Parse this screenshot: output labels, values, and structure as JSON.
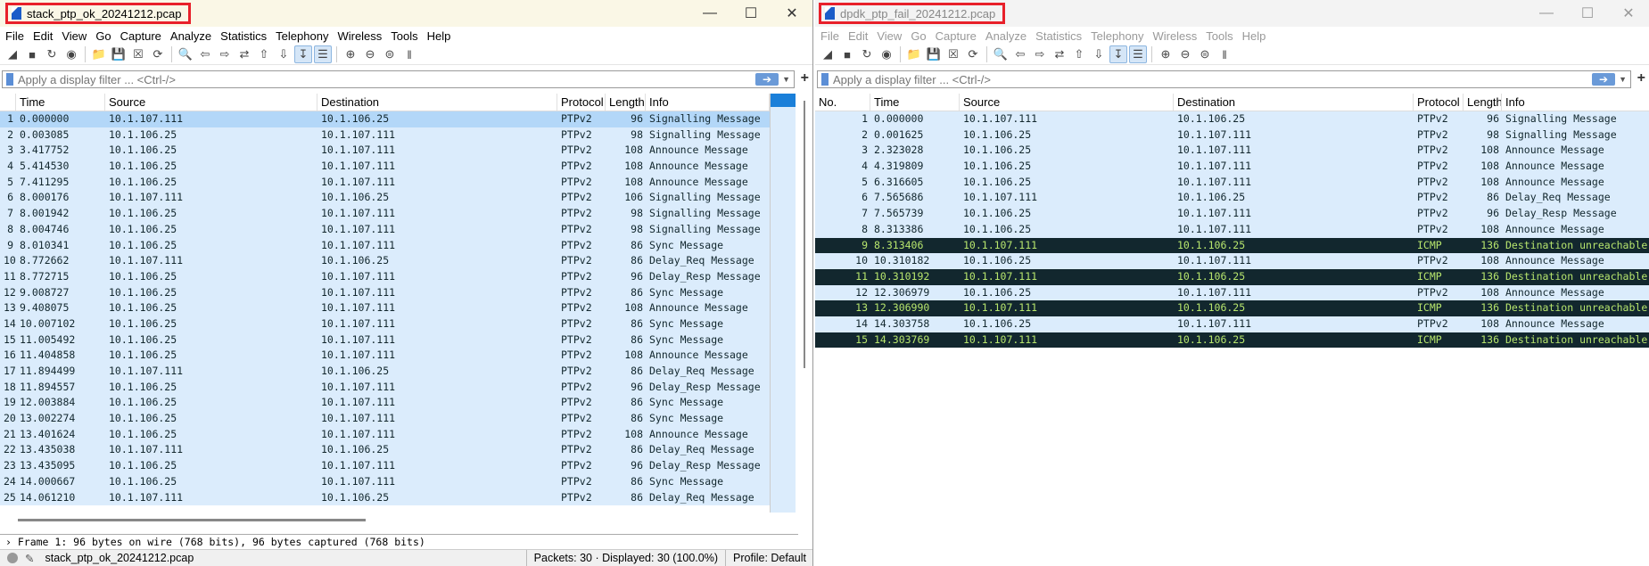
{
  "menu": [
    "File",
    "Edit",
    "View",
    "Go",
    "Capture",
    "Analyze",
    "Statistics",
    "Telephony",
    "Wireless",
    "Tools",
    "Help"
  ],
  "filter_placeholder": "Apply a display filter ... <Ctrl-/>",
  "columns": [
    "No.",
    "Time",
    "Source",
    "Destination",
    "Protocol",
    "Length",
    "Info"
  ],
  "left": {
    "title": "stack_ptp_ok_20241212.pcap",
    "header_no": "",
    "rows": [
      [
        "1",
        "0.000000",
        "10.1.107.111",
        "10.1.106.25",
        "PTPv2",
        "96",
        "Signalling Message"
      ],
      [
        "2",
        "0.003085",
        "10.1.106.25",
        "10.1.107.111",
        "PTPv2",
        "98",
        "Signalling Message"
      ],
      [
        "3",
        "3.417752",
        "10.1.106.25",
        "10.1.107.111",
        "PTPv2",
        "108",
        "Announce Message"
      ],
      [
        "4",
        "5.414530",
        "10.1.106.25",
        "10.1.107.111",
        "PTPv2",
        "108",
        "Announce Message"
      ],
      [
        "5",
        "7.411295",
        "10.1.106.25",
        "10.1.107.111",
        "PTPv2",
        "108",
        "Announce Message"
      ],
      [
        "6",
        "8.000176",
        "10.1.107.111",
        "10.1.106.25",
        "PTPv2",
        "106",
        "Signalling Message"
      ],
      [
        "7",
        "8.001942",
        "10.1.106.25",
        "10.1.107.111",
        "PTPv2",
        "98",
        "Signalling Message"
      ],
      [
        "8",
        "8.004746",
        "10.1.106.25",
        "10.1.107.111",
        "PTPv2",
        "98",
        "Signalling Message"
      ],
      [
        "9",
        "8.010341",
        "10.1.106.25",
        "10.1.107.111",
        "PTPv2",
        "86",
        "Sync Message"
      ],
      [
        "10",
        "8.772662",
        "10.1.107.111",
        "10.1.106.25",
        "PTPv2",
        "86",
        "Delay_Req Message"
      ],
      [
        "11",
        "8.772715",
        "10.1.106.25",
        "10.1.107.111",
        "PTPv2",
        "96",
        "Delay_Resp Message"
      ],
      [
        "12",
        "9.008727",
        "10.1.106.25",
        "10.1.107.111",
        "PTPv2",
        "86",
        "Sync Message"
      ],
      [
        "13",
        "9.408075",
        "10.1.106.25",
        "10.1.107.111",
        "PTPv2",
        "108",
        "Announce Message"
      ],
      [
        "14",
        "10.007102",
        "10.1.106.25",
        "10.1.107.111",
        "PTPv2",
        "86",
        "Sync Message"
      ],
      [
        "15",
        "11.005492",
        "10.1.106.25",
        "10.1.107.111",
        "PTPv2",
        "86",
        "Sync Message"
      ],
      [
        "16",
        "11.404858",
        "10.1.106.25",
        "10.1.107.111",
        "PTPv2",
        "108",
        "Announce Message"
      ],
      [
        "17",
        "11.894499",
        "10.1.107.111",
        "10.1.106.25",
        "PTPv2",
        "86",
        "Delay_Req Message"
      ],
      [
        "18",
        "11.894557",
        "10.1.106.25",
        "10.1.107.111",
        "PTPv2",
        "96",
        "Delay_Resp Message"
      ],
      [
        "19",
        "12.003884",
        "10.1.106.25",
        "10.1.107.111",
        "PTPv2",
        "86",
        "Sync Message"
      ],
      [
        "20",
        "13.002274",
        "10.1.106.25",
        "10.1.107.111",
        "PTPv2",
        "86",
        "Sync Message"
      ],
      [
        "21",
        "13.401624",
        "10.1.106.25",
        "10.1.107.111",
        "PTPv2",
        "108",
        "Announce Message"
      ],
      [
        "22",
        "13.435038",
        "10.1.107.111",
        "10.1.106.25",
        "PTPv2",
        "86",
        "Delay_Req Message"
      ],
      [
        "23",
        "13.435095",
        "10.1.106.25",
        "10.1.107.111",
        "PTPv2",
        "96",
        "Delay_Resp Message"
      ],
      [
        "24",
        "14.000667",
        "10.1.106.25",
        "10.1.107.111",
        "PTPv2",
        "86",
        "Sync Message"
      ],
      [
        "25",
        "14.061210",
        "10.1.107.111",
        "10.1.106.25",
        "PTPv2",
        "86",
        "Delay_Req Message"
      ]
    ],
    "detail": "Frame 1: 96 bytes on wire (768 bits), 96 bytes captured (768 bits)",
    "status_file": "stack_ptp_ok_20241212.pcap",
    "status_packets": "Packets: 30 · Displayed: 30 (100.0%)",
    "status_profile": "Profile: Default"
  },
  "right": {
    "title": "dpdk_ptp_fail_20241212.pcap",
    "rows": [
      [
        "1",
        "0.000000",
        "10.1.107.111",
        "10.1.106.25",
        "PTPv2",
        "96",
        "Signalling Message"
      ],
      [
        "2",
        "0.001625",
        "10.1.106.25",
        "10.1.107.111",
        "PTPv2",
        "98",
        "Signalling Message"
      ],
      [
        "3",
        "2.323028",
        "10.1.106.25",
        "10.1.107.111",
        "PTPv2",
        "108",
        "Announce Message"
      ],
      [
        "4",
        "4.319809",
        "10.1.106.25",
        "10.1.107.111",
        "PTPv2",
        "108",
        "Announce Message"
      ],
      [
        "5",
        "6.316605",
        "10.1.106.25",
        "10.1.107.111",
        "PTPv2",
        "108",
        "Announce Message"
      ],
      [
        "6",
        "7.565686",
        "10.1.107.111",
        "10.1.106.25",
        "PTPv2",
        "86",
        "Delay_Req Message"
      ],
      [
        "7",
        "7.565739",
        "10.1.106.25",
        "10.1.107.111",
        "PTPv2",
        "96",
        "Delay_Resp Message"
      ],
      [
        "8",
        "8.313386",
        "10.1.106.25",
        "10.1.107.111",
        "PTPv2",
        "108",
        "Announce Message"
      ],
      [
        "9",
        "8.313406",
        "10.1.107.111",
        "10.1.106.25",
        "ICMP",
        "136",
        "Destination unreachable"
      ],
      [
        "10",
        "10.310182",
        "10.1.106.25",
        "10.1.107.111",
        "PTPv2",
        "108",
        "Announce Message"
      ],
      [
        "11",
        "10.310192",
        "10.1.107.111",
        "10.1.106.25",
        "ICMP",
        "136",
        "Destination unreachable"
      ],
      [
        "12",
        "12.306979",
        "10.1.106.25",
        "10.1.107.111",
        "PTPv2",
        "108",
        "Announce Message"
      ],
      [
        "13",
        "12.306990",
        "10.1.107.111",
        "10.1.106.25",
        "ICMP",
        "136",
        "Destination unreachable"
      ],
      [
        "14",
        "14.303758",
        "10.1.106.25",
        "10.1.107.111",
        "PTPv2",
        "108",
        "Announce Message"
      ],
      [
        "15",
        "14.303769",
        "10.1.107.111",
        "10.1.106.25",
        "ICMP",
        "136",
        "Destination unreachable"
      ]
    ]
  },
  "colors": {
    "row_bg": "#dbecfc",
    "selected_bg": "#b3d7f8",
    "icmp_bg": "#12272e",
    "icmp_fg": "#b7e56d",
    "highlight_box": "#e8202a"
  }
}
